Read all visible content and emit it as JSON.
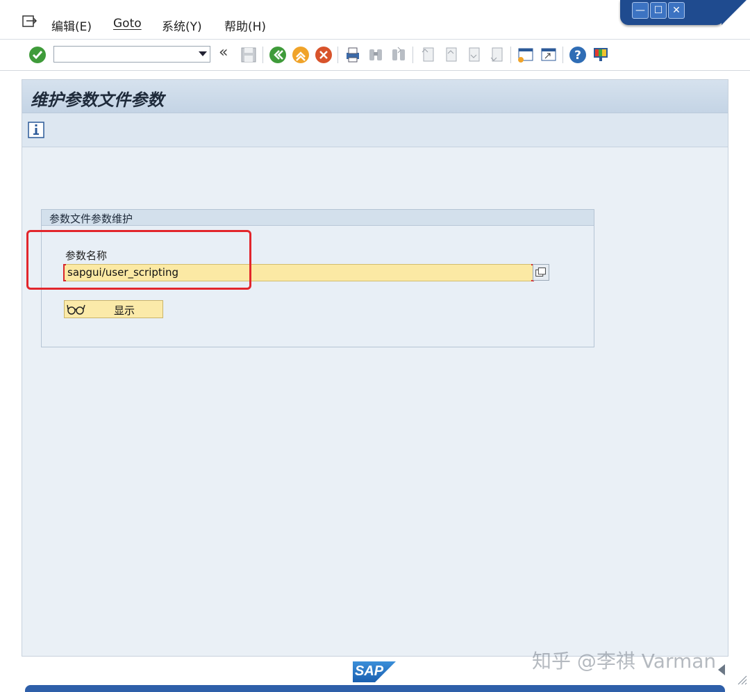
{
  "menu": {
    "items": [
      {
        "label": "编辑(E)"
      },
      {
        "label": "Goto"
      },
      {
        "label": "系统(Y)"
      },
      {
        "label": "帮助(H)"
      }
    ]
  },
  "window_controls": {
    "minimize": "—",
    "maximize": "☐",
    "close": "✕"
  },
  "toolbar": {
    "command_field_value": "",
    "prev_symbol": "«"
  },
  "screen": {
    "title": "维护参数文件参数"
  },
  "group": {
    "title": "参数文件参数维护",
    "field_label": "参数名称",
    "parameter_value": "sapgui/user_scripting",
    "show_button_label": "显示"
  },
  "footer": {
    "logo_text": "SAP",
    "watermark": "知乎 @李祺 Varman"
  },
  "colors": {
    "accent_blue": "#1f4b8f",
    "input_yellow": "#fbe9a4",
    "highlight_red": "#e2262c",
    "panel_bg": "#eaf0f6"
  }
}
